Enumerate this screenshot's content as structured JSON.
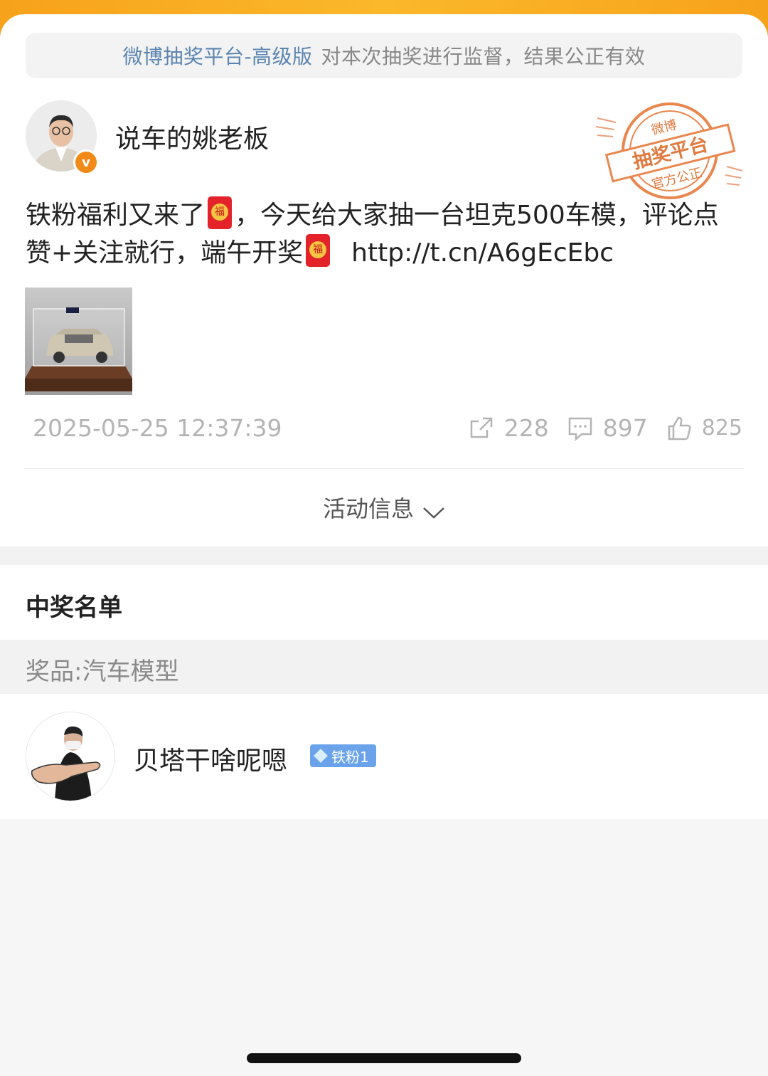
{
  "notice": {
    "highlight": "微博抽奖平台-高级版",
    "text": "对本次抽奖进行监督，结果公正有效"
  },
  "post": {
    "author": "说车的姚老板",
    "verified_badge": "v",
    "text_part1": "铁粉福利又来了",
    "text_part2": "，今天给大家抽一台坦克500车模，评论点赞+关注就行，端午开奖",
    "link": "http://t.cn/A6gEcEbc",
    "timestamp": "2025-05-25 12:37:39",
    "reposts": "228",
    "comments": "897",
    "likes": "825"
  },
  "stamp": {
    "top": "微博",
    "middle": "抽奖平台",
    "bottom": "官方公正"
  },
  "activity_info": "活动信息",
  "winners": {
    "title": "中奖名单",
    "prize": "奖品:汽车模型",
    "list": [
      {
        "name": "贝塔干啥呢嗯",
        "badge": "铁粉1"
      }
    ]
  },
  "colors": {
    "accent": "#f7a21b",
    "link_blue": "#5b84b1",
    "badge_blue": "#6aa3ea"
  }
}
